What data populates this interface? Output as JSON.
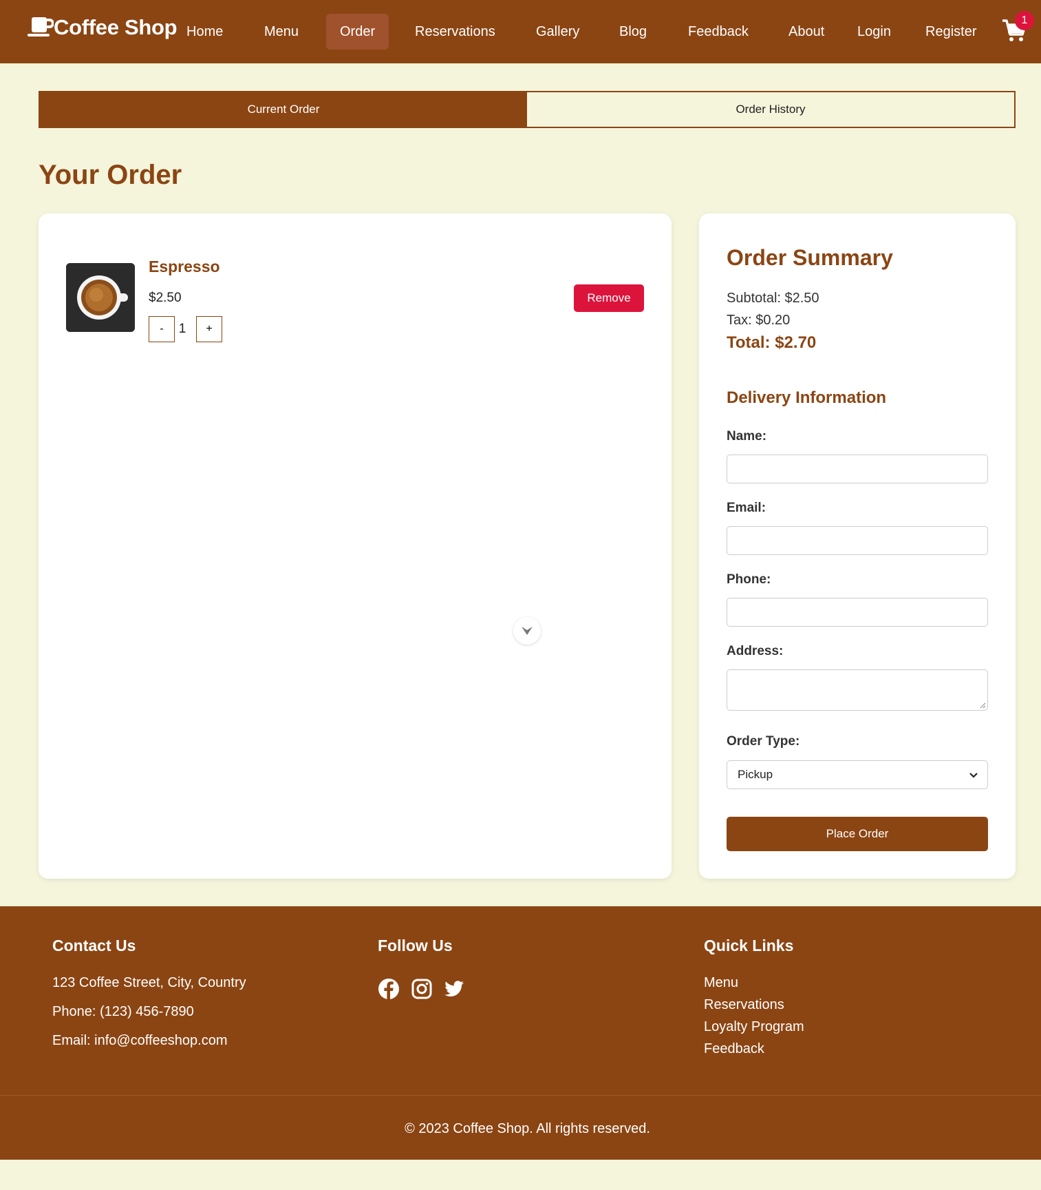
{
  "nav": {
    "brand": "Coffee Shop",
    "items": [
      "Home",
      "Menu",
      "Order",
      "Reservations",
      "Gallery",
      "Blog",
      "Feedback",
      "About",
      "Login",
      "Register"
    ],
    "active": "Order",
    "cart_count": "1"
  },
  "tabs": {
    "current": "Current Order",
    "history": "Order History"
  },
  "page_title": "Your Order",
  "order": {
    "item": {
      "name": "Espresso",
      "price": "$2.50",
      "quantity": "1"
    },
    "minus_label": "-",
    "plus_label": "+",
    "remove_label": "Remove"
  },
  "summary": {
    "title": "Order Summary",
    "subtotal": "Subtotal: $2.50",
    "tax": "Tax: $0.20",
    "total": "Total: $2.70"
  },
  "delivery": {
    "title": "Delivery Information",
    "name_label": "Name:",
    "email_label": "Email:",
    "phone_label": "Phone:",
    "address_label": "Address:",
    "order_type_label": "Order Type:",
    "order_type_value": "Pickup",
    "place_order": "Place Order"
  },
  "footer": {
    "contact_title": "Contact Us",
    "address": "123 Coffee Street, City, Country",
    "phone": "Phone: (123) 456-7890",
    "email": "Email: info@coffeeshop.com",
    "follow_title": "Follow Us",
    "social_icons": [
      "facebook-icon",
      "instagram-icon",
      "twitter-icon"
    ],
    "quick_title": "Quick Links",
    "quick_links": [
      "Menu",
      "Reservations",
      "Loyalty Program",
      "Feedback"
    ],
    "copyright": "© 2023 Coffee Shop. All rights reserved."
  },
  "colors": {
    "brand": "#8b4513",
    "active_nav": "#a0522d",
    "danger": "#dc143c",
    "page_bg": "#f5f5dc"
  }
}
